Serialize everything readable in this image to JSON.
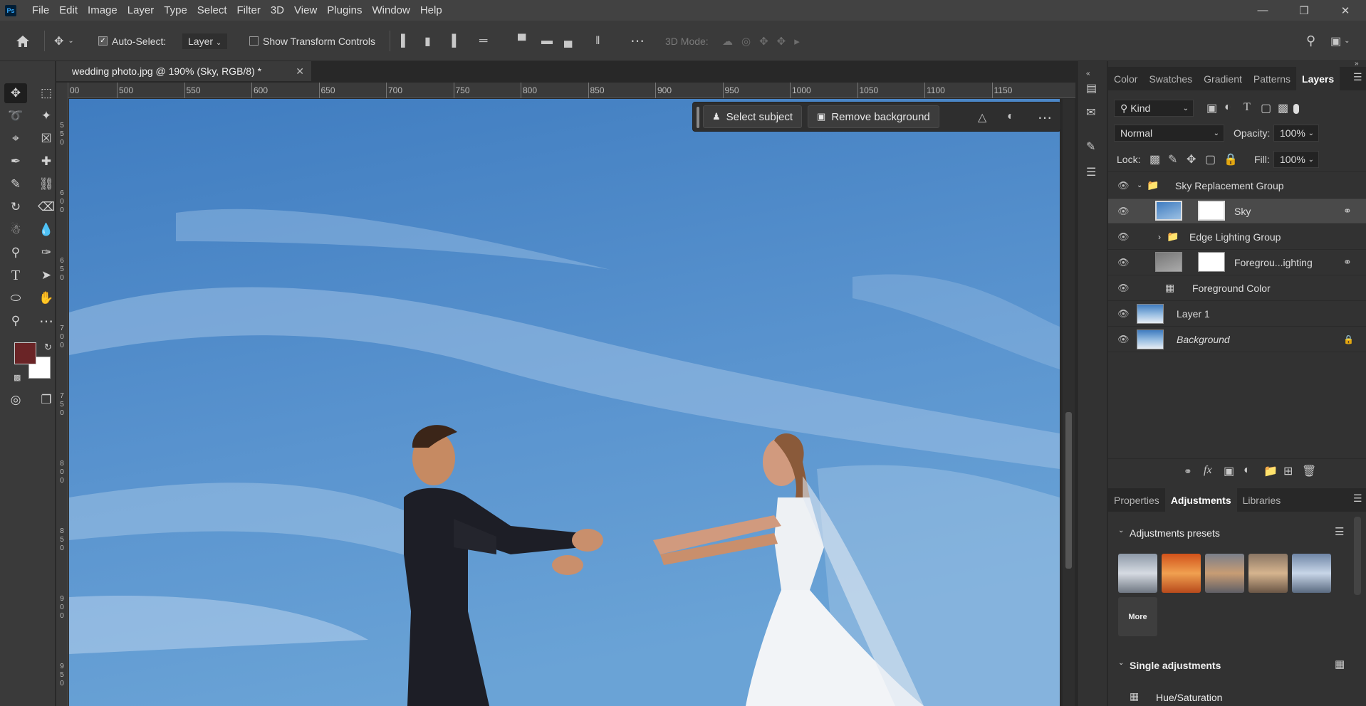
{
  "app": {
    "logo": "Ps"
  },
  "menubar": {
    "items": [
      "File",
      "Edit",
      "Image",
      "Layer",
      "Type",
      "Select",
      "Filter",
      "3D",
      "View",
      "Plugins",
      "Window",
      "Help"
    ]
  },
  "options": {
    "auto_select_label": "Auto-Select:",
    "auto_select_checked": true,
    "auto_select_target": "Layer",
    "show_transform_label": "Show Transform Controls",
    "threed_label": "3D Mode:"
  },
  "document": {
    "tab_title": "wedding photo.jpg @ 190% (Sky, RGB/8) *"
  },
  "ruler": {
    "h_ticks": [
      "00",
      "500",
      "550",
      "600",
      "650",
      "700",
      "750",
      "800",
      "850",
      "900",
      "950",
      "1000",
      "1050",
      "1100",
      "1150"
    ],
    "v_ticks": [
      "5\n5\n0",
      "6\n0\n0",
      "6\n5\n0",
      "7\n0\n0",
      "7\n5\n0",
      "8\n0\n0",
      "8\n5\n0",
      "9\n0\n0",
      "9\n5\n0"
    ]
  },
  "contextbar": {
    "select_subject": "Select subject",
    "remove_background": "Remove background"
  },
  "colors": {
    "foreground": "#6a2426",
    "background": "#ffffff",
    "accent": "#4a84c4"
  },
  "layers_panel": {
    "tabs": [
      "Color",
      "Swatches",
      "Gradient",
      "Patterns",
      "Layers"
    ],
    "active_tab": "Layers",
    "filter_kind": "Kind",
    "blend_mode": "Normal",
    "opacity_label": "Opacity:",
    "opacity": "100%",
    "lock_label": "Lock:",
    "fill_label": "Fill:",
    "fill": "100%",
    "layers": [
      {
        "name": "Sky Replacement Group",
        "type": "group"
      },
      {
        "name": "Sky",
        "type": "layer"
      },
      {
        "name": "Edge Lighting Group",
        "type": "group"
      },
      {
        "name": "Foregrou...ighting",
        "type": "layer"
      },
      {
        "name": "Foreground Color",
        "type": "adjustment"
      },
      {
        "name": "Layer 1",
        "type": "layer"
      },
      {
        "name": "Background",
        "type": "layer"
      }
    ]
  },
  "adjustments_panel": {
    "tabs": [
      "Properties",
      "Adjustments",
      "Libraries"
    ],
    "active_tab": "Adjustments",
    "presets_title": "Adjustments presets",
    "more_label": "More",
    "single_title": "Single adjustments",
    "first_item": "Hue/Saturation"
  }
}
